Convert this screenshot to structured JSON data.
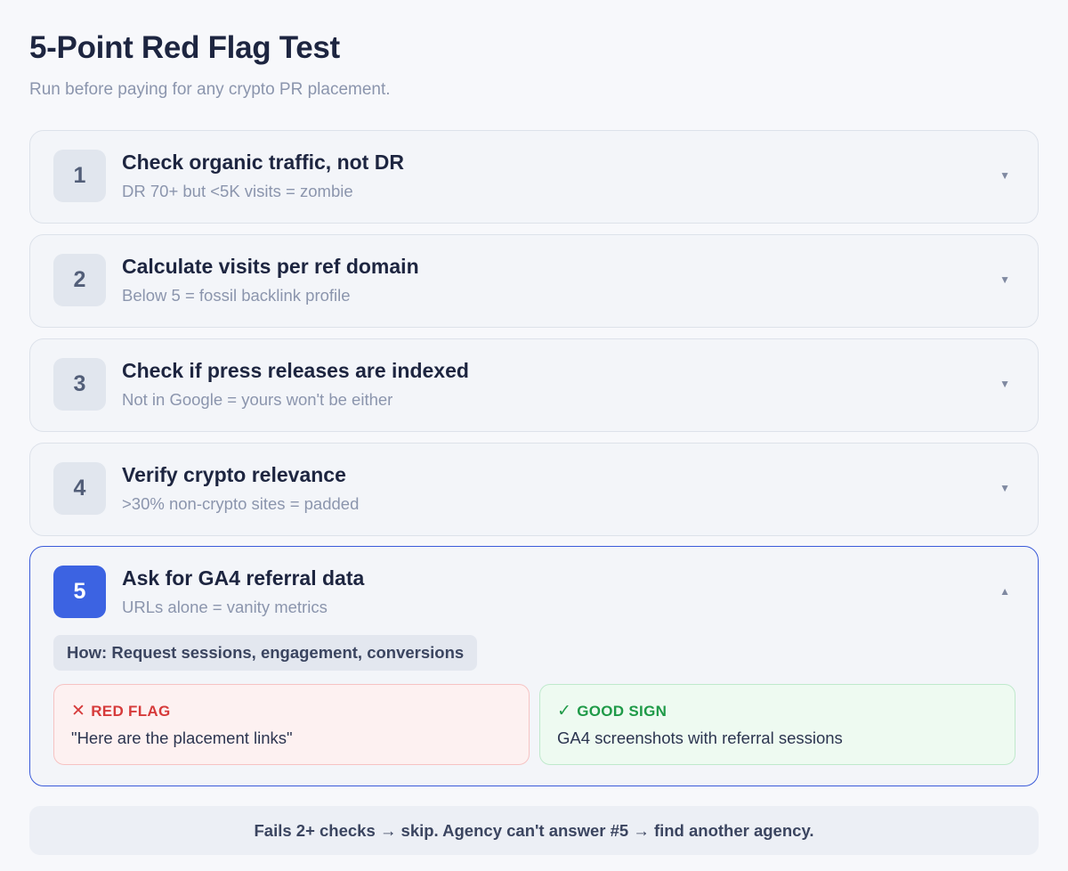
{
  "header": {
    "title": "5-Point Red Flag Test",
    "subtitle": "Run before paying for any crypto PR placement."
  },
  "checks": [
    {
      "number": "1",
      "title": "Check organic traffic, not DR",
      "subtitle": "DR 70+ but <5K visits = zombie",
      "chevron": "▼",
      "icon": "chevron-down-icon",
      "expanded": false
    },
    {
      "number": "2",
      "title": "Calculate visits per ref domain",
      "subtitle": "Below 5 = fossil backlink profile",
      "chevron": "▼",
      "icon": "chevron-down-icon",
      "expanded": false
    },
    {
      "number": "3",
      "title": "Check if press releases are indexed",
      "subtitle": "Not in Google = yours won't be either",
      "chevron": "▼",
      "icon": "chevron-down-icon",
      "expanded": false
    },
    {
      "number": "4",
      "title": "Verify crypto relevance",
      "subtitle": ">30% non-crypto sites = padded",
      "chevron": "▼",
      "icon": "chevron-down-icon",
      "expanded": false
    },
    {
      "number": "5",
      "title": "Ask for GA4 referral data",
      "subtitle": "URLs alone = vanity metrics",
      "chevron": "▲",
      "icon": "chevron-up-icon",
      "expanded": true,
      "how": "How: Request sessions, engagement, conversions",
      "red_flag": {
        "icon": "✕",
        "label": "RED FLAG",
        "text": "\"Here are the placement links\""
      },
      "good_sign": {
        "icon": "✓",
        "label": "GOOD SIGN",
        "text": "GA4 screenshots with referral sessions"
      }
    }
  ],
  "footer": {
    "text": "Fails 2+ checks → skip. Agency can't answer #5 → find another agency."
  },
  "colors": {
    "accent": "#3c63e2",
    "red": "#d63b3b",
    "green": "#1f9a48"
  }
}
